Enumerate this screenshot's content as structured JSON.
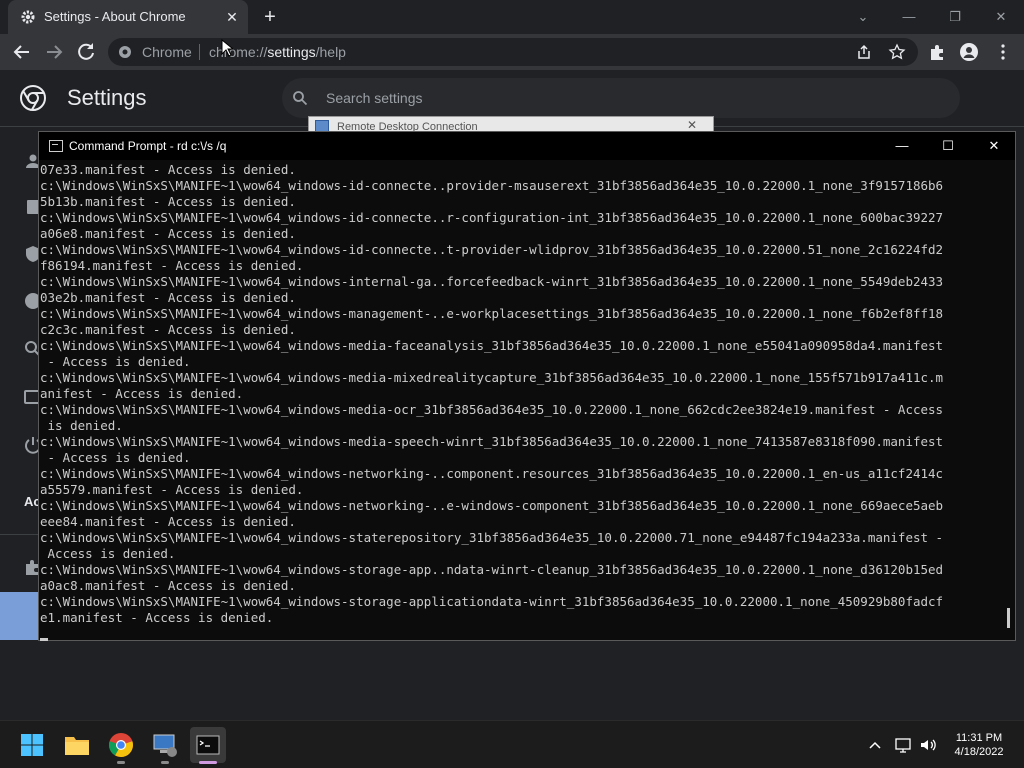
{
  "browser": {
    "tab": {
      "title": "Settings - About Chrome",
      "close": "✕"
    },
    "new_tab": "+",
    "window_controls": {
      "dropdown": "⌄",
      "minimize": "—",
      "restore": "❐",
      "close": "✕"
    },
    "omnibox": {
      "site": "Chrome",
      "url_scheme": "chrome://",
      "url_host": "settings",
      "url_path": "/help"
    }
  },
  "settings": {
    "title": "Settings",
    "search_placeholder": "Search settings",
    "sidebar_partial_label": "Ac"
  },
  "rdc_window": {
    "title": "Remote Desktop Connection",
    "close": "✕"
  },
  "cmd": {
    "title": "Command Prompt - rd  c:\\/s /q",
    "controls": {
      "minimize": "—",
      "maximize": "☐",
      "close": "✕"
    },
    "lines": [
      "07e33.manifest - Access is denied.",
      "c:\\Windows\\WinSxS\\MANIFE~1\\wow64_windows-id-connecte..provider-msauserext_31bf3856ad364e35_10.0.22000.1_none_3f9157186b6",
      "5b13b.manifest - Access is denied.",
      "c:\\Windows\\WinSxS\\MANIFE~1\\wow64_windows-id-connecte..r-configuration-int_31bf3856ad364e35_10.0.22000.1_none_600bac39227",
      "a06e8.manifest - Access is denied.",
      "c:\\Windows\\WinSxS\\MANIFE~1\\wow64_windows-id-connecte..t-provider-wlidprov_31bf3856ad364e35_10.0.22000.51_none_2c16224fd2",
      "f86194.manifest - Access is denied.",
      "c:\\Windows\\WinSxS\\MANIFE~1\\wow64_windows-internal-ga..forcefeedback-winrt_31bf3856ad364e35_10.0.22000.1_none_5549deb2433",
      "03e2b.manifest - Access is denied.",
      "c:\\Windows\\WinSxS\\MANIFE~1\\wow64_windows-management-..e-workplacesettings_31bf3856ad364e35_10.0.22000.1_none_f6b2ef8ff18",
      "c2c3c.manifest - Access is denied.",
      "c:\\Windows\\WinSxS\\MANIFE~1\\wow64_windows-media-faceanalysis_31bf3856ad364e35_10.0.22000.1_none_e55041a090958da4.manifest",
      " - Access is denied.",
      "c:\\Windows\\WinSxS\\MANIFE~1\\wow64_windows-media-mixedrealitycapture_31bf3856ad364e35_10.0.22000.1_none_155f571b917a411c.m",
      "anifest - Access is denied.",
      "c:\\Windows\\WinSxS\\MANIFE~1\\wow64_windows-media-ocr_31bf3856ad364e35_10.0.22000.1_none_662cdc2ee3824e19.manifest - Access",
      " is denied.",
      "c:\\Windows\\WinSxS\\MANIFE~1\\wow64_windows-media-speech-winrt_31bf3856ad364e35_10.0.22000.1_none_7413587e8318f090.manifest",
      " - Access is denied.",
      "c:\\Windows\\WinSxS\\MANIFE~1\\wow64_windows-networking-..component.resources_31bf3856ad364e35_10.0.22000.1_en-us_a11cf2414c",
      "a55579.manifest - Access is denied.",
      "c:\\Windows\\WinSxS\\MANIFE~1\\wow64_windows-networking-..e-windows-component_31bf3856ad364e35_10.0.22000.1_none_669aece5aeb",
      "eee84.manifest - Access is denied.",
      "c:\\Windows\\WinSxS\\MANIFE~1\\wow64_windows-staterepository_31bf3856ad364e35_10.0.22000.71_none_e94487fc194a233a.manifest -",
      " Access is denied.",
      "c:\\Windows\\WinSxS\\MANIFE~1\\wow64_windows-storage-app..ndata-winrt-cleanup_31bf3856ad364e35_10.0.22000.1_none_d36120b15ed",
      "a0ac8.manifest - Access is denied.",
      "c:\\Windows\\WinSxS\\MANIFE~1\\wow64_windows-storage-applicationdata-winrt_31bf3856ad364e35_10.0.22000.1_none_450929b80fadcf",
      "e1.manifest - Access is denied."
    ]
  },
  "taskbar": {
    "apps": [
      "start-icon",
      "file-explorer-icon",
      "chrome-icon",
      "remote-desktop-icon",
      "terminal-icon"
    ],
    "clock": {
      "time": "11:31 PM",
      "date": "4/18/2022"
    }
  },
  "colors": {
    "chrome_bg": "#202124",
    "toolbar": "#35363a",
    "cmd_bg": "#0c0c0c",
    "cmd_text": "#cccccc",
    "taskbar": "#1c1c1c",
    "accent": "#8ab4f8"
  }
}
